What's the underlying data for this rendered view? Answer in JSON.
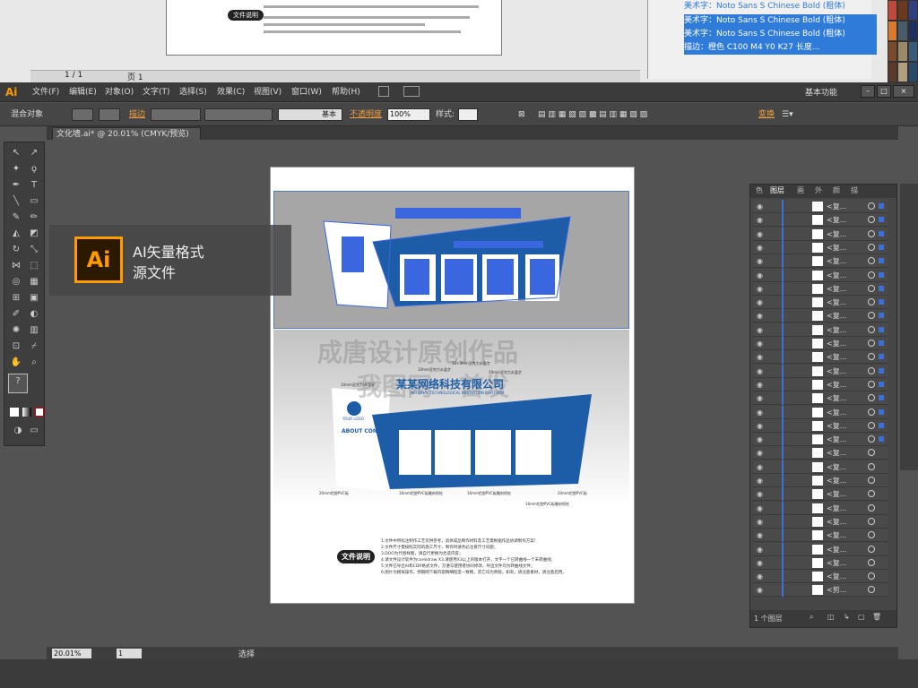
{
  "app": {
    "logo": "Ai",
    "workspace": "基本功能"
  },
  "menu": [
    "文件(F)",
    "编辑(E)",
    "对象(O)",
    "文字(T)",
    "选择(S)",
    "效果(C)",
    "视图(V)",
    "窗口(W)",
    "帮助(H)"
  ],
  "control": {
    "selection": "混合对象",
    "stroke_label": "描边",
    "stroke_style": "基本",
    "opacity_label": "不透明度",
    "opacity_value": "100%",
    "style_label": "样式:",
    "transform_label": "变换"
  },
  "document_tab": "文化墙.ai* @ 20.01% (CMYK/预览)",
  "background_window": {
    "doc_tag": "文件说明",
    "page_nav": "1 / 1",
    "page_label": "页 1"
  },
  "background_layers": [
    "美术字：Noto Sans S Chinese Bold (粗体)",
    "美术字：Noto Sans S Chinese Bold (粗体)",
    "美术字：Noto Sans S Chinese Bold (粗体)",
    "描边：橙色 C100 M4 Y0 K27 长度..."
  ],
  "badge": {
    "icon": "Ai",
    "line1": "AI矢量格式",
    "line2": "源文件"
  },
  "artwork": {
    "watermark1": "成唐设计原创作品",
    "watermark2": "我图网 · 首发",
    "company": "某某网络科技有限公司",
    "company_en": "NATIONAL TECHNOLOGICAL INNOVATION PLATFORM",
    "tagline": "诚信服务 · 改革创新 · 合作共赢",
    "about": "ABOUT CONTENTS",
    "logo": "YOUR LOGO",
    "annotations": [
      "10mm亚克力UV面印",
      "10mm亚克力水晶字",
      "10+3mm亚克力水晶字",
      "10mm亚克力水晶字",
      "20mm铝塑PVC板",
      "16mm铝塑PVC板雕刻喷绘",
      "16mm铝塑PVC板雕刻喷绘",
      "16mm铝塑PVC板雕刻喷绘",
      "20mm铝塑PVC板"
    ],
    "doc_label": "文件说明",
    "notes": [
      "1.文件中所标注制作工艺仅供参考，具体成品制作材料及工艺需根据作品协调制作方案！",
      "2.文件尺寸需按照实际的施工尺寸，制作时请务必注意尺寸问题；",
      "3.DOO为代替样图，请自行更换为合适内容；",
      "4.请文件设计软件为coreldraw X3,请使用X3以上的版本打开，文字一个已转曲线一个未转曲线；",
      "5.文件已导出AI和CDR格式文件，方便与使用者协同修改，导出文件均为转曲线文件；",
      "6.图片为模拟操作，预期网下载内容精细程度一致略，其它均为原版，如有，请注意素材，请注意后用。"
    ]
  },
  "layers": {
    "tabs": [
      "色",
      "图层",
      "画",
      "外",
      "颜",
      "描"
    ],
    "rows": [
      "<复...",
      "<复...",
      "<复...",
      "<复...",
      "<复...",
      "<复...",
      "<复...",
      "<复...",
      "<复...",
      "<复...",
      "<复...",
      "<复...",
      "<复...",
      "<复...",
      "<复...",
      "<复...",
      "<复...",
      "<复...",
      "<复...",
      "<复...",
      "<复...",
      "<复...",
      "<复...",
      "<复...",
      "<复...",
      "<复...",
      "<复...",
      "<复...",
      "<剪..."
    ],
    "footer": "1 个图层"
  },
  "status": {
    "zoom": "20.01%",
    "page": "1",
    "tool": "选择"
  }
}
